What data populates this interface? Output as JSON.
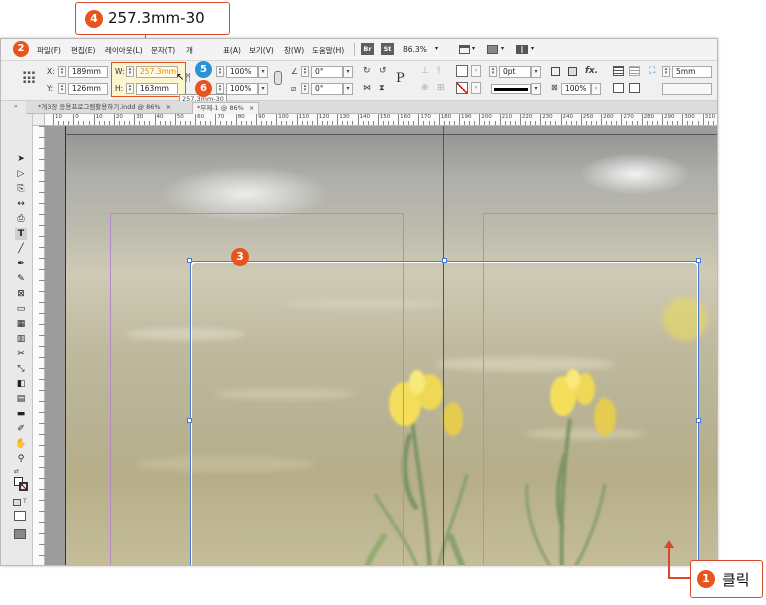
{
  "callouts": {
    "step1": {
      "number": "1",
      "text": "클릭"
    },
    "step2": {
      "number": "2"
    },
    "step3": {
      "number": "3"
    },
    "step4": {
      "number": "4",
      "text": "257.3mm-30"
    },
    "step5": {
      "number": "5"
    },
    "step6": {
      "number": "6"
    }
  },
  "menubar": {
    "items": [
      "파일(F)",
      "편집(E)",
      "레이아웃(L)",
      "문자(T)",
      "개",
      "표(A)",
      "보기(V)",
      "창(W)",
      "도움말(H)"
    ],
    "br_icon": "Br",
    "st_icon": "St",
    "zoom": "86.3%"
  },
  "control": {
    "x_label": "X:",
    "x_value": "189mm",
    "y_label": "Y:",
    "y_value": "126mm",
    "w_label": "W:",
    "w_value": "257.3mm-30",
    "h_label": "H:",
    "h_value": "163mm",
    "tooltip": "257.3mm-30",
    "scale_x": "100%",
    "scale_y": "100%",
    "angle": "0°",
    "shear": "0°",
    "stroke_weight": "0pt",
    "opacity": "100%",
    "corner_size": "5mm",
    "text_frame_glyph": "P",
    "fx_label": "fx."
  },
  "tabs": [
    {
      "label": "*개3장 응용프로그램활용하기.indd @ 86%",
      "close": "×"
    },
    {
      "label": "*무제-1 @ 86%",
      "close": "×"
    }
  ],
  "ruler": {
    "labels": [
      "10",
      "0",
      "10",
      "20",
      "30",
      "40",
      "50",
      "60",
      "70",
      "80",
      "90",
      "100",
      "110",
      "120",
      "130",
      "140",
      "150",
      "160",
      "170",
      "180",
      "190",
      "200",
      "210",
      "220",
      "230",
      "240",
      "250",
      "260",
      "270",
      "280",
      "290",
      "300",
      "310",
      "320"
    ]
  },
  "icons": {
    "link": "link-icon",
    "rotate": "rotate-icon",
    "flip": "flip-icon",
    "hand": "hand-icon",
    "zoom": "zoom-icon"
  },
  "colors": {
    "callout_orange": "#e8541e",
    "callout_blue": "#2a93d5",
    "selection": "#4a7bd0",
    "field_highlight": "#fbf6d0"
  }
}
